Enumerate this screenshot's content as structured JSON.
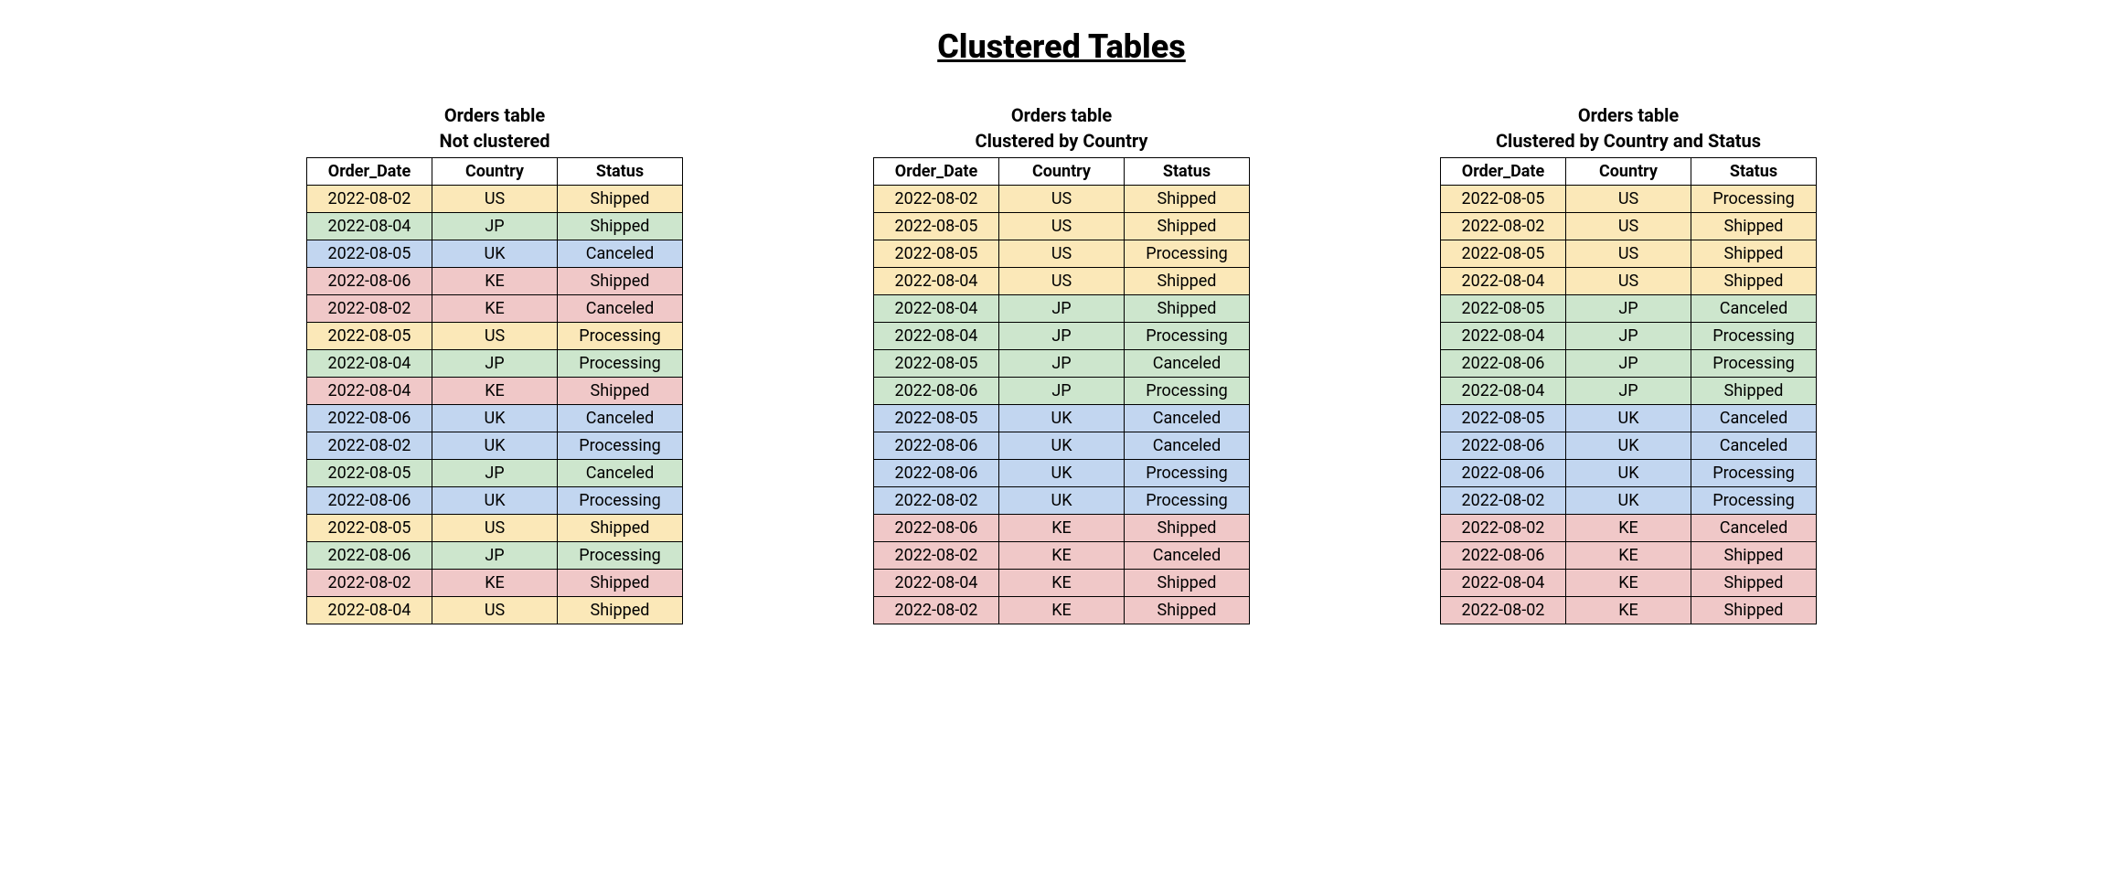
{
  "title": "Clustered Tables",
  "columns": [
    "Order_Date",
    "Country",
    "Status"
  ],
  "countryColors": {
    "US": "c-US",
    "JP": "c-JP",
    "UK": "c-UK",
    "KE": "c-KE"
  },
  "tables": [
    {
      "caption": "Orders table",
      "subcaption": "Not clustered",
      "rows": [
        {
          "date": "2022-08-02",
          "country": "US",
          "status": "Shipped"
        },
        {
          "date": "2022-08-04",
          "country": "JP",
          "status": "Shipped"
        },
        {
          "date": "2022-08-05",
          "country": "UK",
          "status": "Canceled"
        },
        {
          "date": "2022-08-06",
          "country": "KE",
          "status": "Shipped"
        },
        {
          "date": "2022-08-02",
          "country": "KE",
          "status": "Canceled"
        },
        {
          "date": "2022-08-05",
          "country": "US",
          "status": "Processing"
        },
        {
          "date": "2022-08-04",
          "country": "JP",
          "status": "Processing"
        },
        {
          "date": "2022-08-04",
          "country": "KE",
          "status": "Shipped"
        },
        {
          "date": "2022-08-06",
          "country": "UK",
          "status": "Canceled"
        },
        {
          "date": "2022-08-02",
          "country": "UK",
          "status": "Processing"
        },
        {
          "date": "2022-08-05",
          "country": "JP",
          "status": "Canceled"
        },
        {
          "date": "2022-08-06",
          "country": "UK",
          "status": "Processing"
        },
        {
          "date": "2022-08-05",
          "country": "US",
          "status": "Shipped"
        },
        {
          "date": "2022-08-06",
          "country": "JP",
          "status": "Processing"
        },
        {
          "date": "2022-08-02",
          "country": "KE",
          "status": "Shipped"
        },
        {
          "date": "2022-08-04",
          "country": "US",
          "status": "Shipped"
        }
      ],
      "groupStarts": []
    },
    {
      "caption": "Orders table",
      "subcaption": "Clustered by Country",
      "rows": [
        {
          "date": "2022-08-02",
          "country": "US",
          "status": "Shipped"
        },
        {
          "date": "2022-08-05",
          "country": "US",
          "status": "Shipped"
        },
        {
          "date": "2022-08-05",
          "country": "US",
          "status": "Processing"
        },
        {
          "date": "2022-08-04",
          "country": "US",
          "status": "Shipped"
        },
        {
          "date": "2022-08-04",
          "country": "JP",
          "status": "Shipped"
        },
        {
          "date": "2022-08-04",
          "country": "JP",
          "status": "Processing"
        },
        {
          "date": "2022-08-05",
          "country": "JP",
          "status": "Canceled"
        },
        {
          "date": "2022-08-06",
          "country": "JP",
          "status": "Processing"
        },
        {
          "date": "2022-08-05",
          "country": "UK",
          "status": "Canceled"
        },
        {
          "date": "2022-08-06",
          "country": "UK",
          "status": "Canceled"
        },
        {
          "date": "2022-08-06",
          "country": "UK",
          "status": "Processing"
        },
        {
          "date": "2022-08-02",
          "country": "UK",
          "status": "Processing"
        },
        {
          "date": "2022-08-06",
          "country": "KE",
          "status": "Shipped"
        },
        {
          "date": "2022-08-02",
          "country": "KE",
          "status": "Canceled"
        },
        {
          "date": "2022-08-04",
          "country": "KE",
          "status": "Shipped"
        },
        {
          "date": "2022-08-02",
          "country": "KE",
          "status": "Shipped"
        }
      ],
      "groupStarts": [
        4,
        8,
        12
      ]
    },
    {
      "caption": "Orders table",
      "subcaption": "Clustered by Country and Status",
      "rows": [
        {
          "date": "2022-08-05",
          "country": "US",
          "status": "Processing"
        },
        {
          "date": "2022-08-02",
          "country": "US",
          "status": "Shipped"
        },
        {
          "date": "2022-08-05",
          "country": "US",
          "status": "Shipped"
        },
        {
          "date": "2022-08-04",
          "country": "US",
          "status": "Shipped"
        },
        {
          "date": "2022-08-05",
          "country": "JP",
          "status": "Canceled"
        },
        {
          "date": "2022-08-04",
          "country": "JP",
          "status": "Processing"
        },
        {
          "date": "2022-08-06",
          "country": "JP",
          "status": "Processing"
        },
        {
          "date": "2022-08-04",
          "country": "JP",
          "status": "Shipped"
        },
        {
          "date": "2022-08-05",
          "country": "UK",
          "status": "Canceled"
        },
        {
          "date": "2022-08-06",
          "country": "UK",
          "status": "Canceled"
        },
        {
          "date": "2022-08-06",
          "country": "UK",
          "status": "Processing"
        },
        {
          "date": "2022-08-02",
          "country": "UK",
          "status": "Processing"
        },
        {
          "date": "2022-08-02",
          "country": "KE",
          "status": "Canceled"
        },
        {
          "date": "2022-08-06",
          "country": "KE",
          "status": "Shipped"
        },
        {
          "date": "2022-08-04",
          "country": "KE",
          "status": "Shipped"
        },
        {
          "date": "2022-08-02",
          "country": "KE",
          "status": "Shipped"
        }
      ],
      "groupStarts": [
        4,
        8,
        12
      ]
    }
  ]
}
